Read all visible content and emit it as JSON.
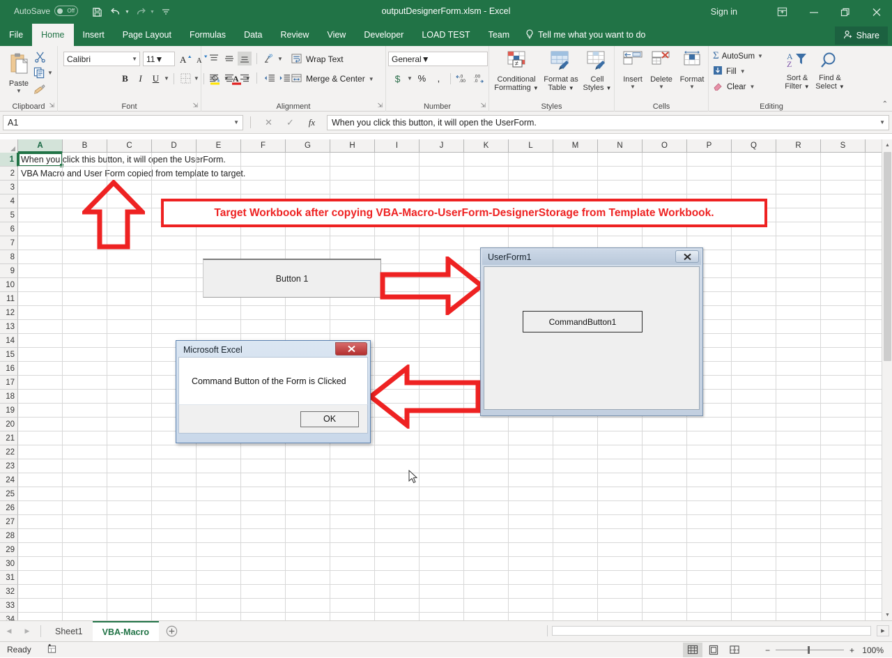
{
  "titlebar": {
    "autosave_label": "AutoSave",
    "autosave_state": "Off",
    "document_title": "outputDesignerForm.xlsm  -  Excel",
    "signin": "Sign in",
    "qat": [
      "save-icon",
      "undo-icon",
      "redo-icon",
      "customize-qat-icon"
    ],
    "window_controls": [
      "ribbon-display-options-icon",
      "minimize-icon",
      "restore-icon",
      "close-icon"
    ],
    "accent_color": "#217346"
  },
  "ribbon": {
    "tabs": [
      {
        "label": "File",
        "active": false
      },
      {
        "label": "Home",
        "active": true
      },
      {
        "label": "Insert",
        "active": false
      },
      {
        "label": "Page Layout",
        "active": false
      },
      {
        "label": "Formulas",
        "active": false
      },
      {
        "label": "Data",
        "active": false
      },
      {
        "label": "Review",
        "active": false
      },
      {
        "label": "View",
        "active": false
      },
      {
        "label": "Developer",
        "active": false
      },
      {
        "label": "LOAD TEST",
        "active": false
      },
      {
        "label": "Team",
        "active": false
      }
    ],
    "tellme": "Tell me what you want to do",
    "share": "Share",
    "groups": {
      "clipboard": {
        "label": "Clipboard",
        "paste": "Paste",
        "cut": "cut-icon",
        "copy": "copy-icon",
        "format_painter": "format-painter-icon"
      },
      "font": {
        "label": "Font",
        "font_name": "Calibri",
        "font_size": "11",
        "grow": "A",
        "shrink": "A",
        "bold": "B",
        "italic": "I",
        "underline": "U",
        "borders": "borders-icon",
        "fill_color": "fill-color-icon",
        "font_color": "A"
      },
      "alignment": {
        "label": "Alignment",
        "wrap_text": "Wrap Text",
        "merge_center": "Merge & Center",
        "orientation": "orientation-icon"
      },
      "number": {
        "label": "Number",
        "format": "General",
        "currency": "$",
        "percent": "%",
        "comma": ",",
        "increase_decimal": "increase-decimal-icon",
        "decrease_decimal": "decrease-decimal-icon"
      },
      "styles": {
        "label": "Styles",
        "conditional_formatting": "Conditional\nFormatting",
        "conditional_formatting_l1": "Conditional",
        "conditional_formatting_l2": "Formatting",
        "format_as_table_l1": "Format as",
        "format_as_table_l2": "Table",
        "cell_styles_l1": "Cell",
        "cell_styles_l2": "Styles"
      },
      "cells": {
        "label": "Cells",
        "insert": "Insert",
        "delete": "Delete",
        "format": "Format"
      },
      "editing": {
        "label": "Editing",
        "autosum": "AutoSum",
        "fill": "Fill",
        "clear": "Clear",
        "sort_filter_l1": "Sort &",
        "sort_filter_l2": "Filter",
        "find_select_l1": "Find &",
        "find_select_l2": "Select"
      }
    }
  },
  "formula_bar": {
    "name_box": "A1",
    "cancel": "cancel-icon",
    "enter": "enter-icon",
    "insert_function": "fx",
    "formula_value": "When you click this button, it will open the UserForm."
  },
  "grid": {
    "columns": [
      "A",
      "B",
      "C",
      "D",
      "E",
      "F",
      "G",
      "H",
      "I",
      "J",
      "K",
      "L",
      "M",
      "N",
      "O",
      "P",
      "Q",
      "R",
      "S"
    ],
    "rows": [
      1,
      2,
      3,
      4,
      5,
      6,
      7,
      8,
      9,
      10,
      11,
      12,
      13,
      14,
      15,
      16,
      17,
      18,
      19,
      20,
      21,
      22,
      23,
      24,
      25,
      26,
      27,
      28,
      29,
      30,
      31,
      32,
      33,
      34
    ],
    "selected_column": "A",
    "selected_row": 1,
    "cells": [
      {
        "ref": "A1",
        "text": "When you click this button, it will open the UserForm."
      },
      {
        "ref": "A2",
        "text": "VBA Macro and User Form copied from template to target."
      }
    ]
  },
  "annotations": {
    "callout_text": "Target Workbook after copying VBA-Macro-UserForm-DesignerStorage from Template Workbook.",
    "callout_color": "#ee2222",
    "arrows": [
      "up-arrow-annotation",
      "right-arrow-annotation",
      "left-arrow-annotation"
    ]
  },
  "form_control": {
    "button_label": "Button 1"
  },
  "userform": {
    "title": "UserForm1",
    "close_label": "✕",
    "command_button": "CommandButton1"
  },
  "msgbox": {
    "title": "Microsoft Excel",
    "close_label": "✕",
    "message": "Command Button of the Form is Clicked",
    "ok_label": "OK"
  },
  "sheet_tabs": {
    "prev": "prev-sheet-icon",
    "next": "next-sheet-icon",
    "tabs": [
      {
        "label": "Sheet1",
        "active": false
      },
      {
        "label": "VBA-Macro",
        "active": true
      }
    ],
    "add": "add-sheet-icon"
  },
  "status_bar": {
    "status": "Ready",
    "macro_icon": "record-macro-icon",
    "views": [
      "normal-view-icon",
      "page-layout-view-icon",
      "page-break-preview-icon"
    ],
    "zoom_out": "−",
    "zoom_in": "+",
    "zoom_level": "100%"
  }
}
